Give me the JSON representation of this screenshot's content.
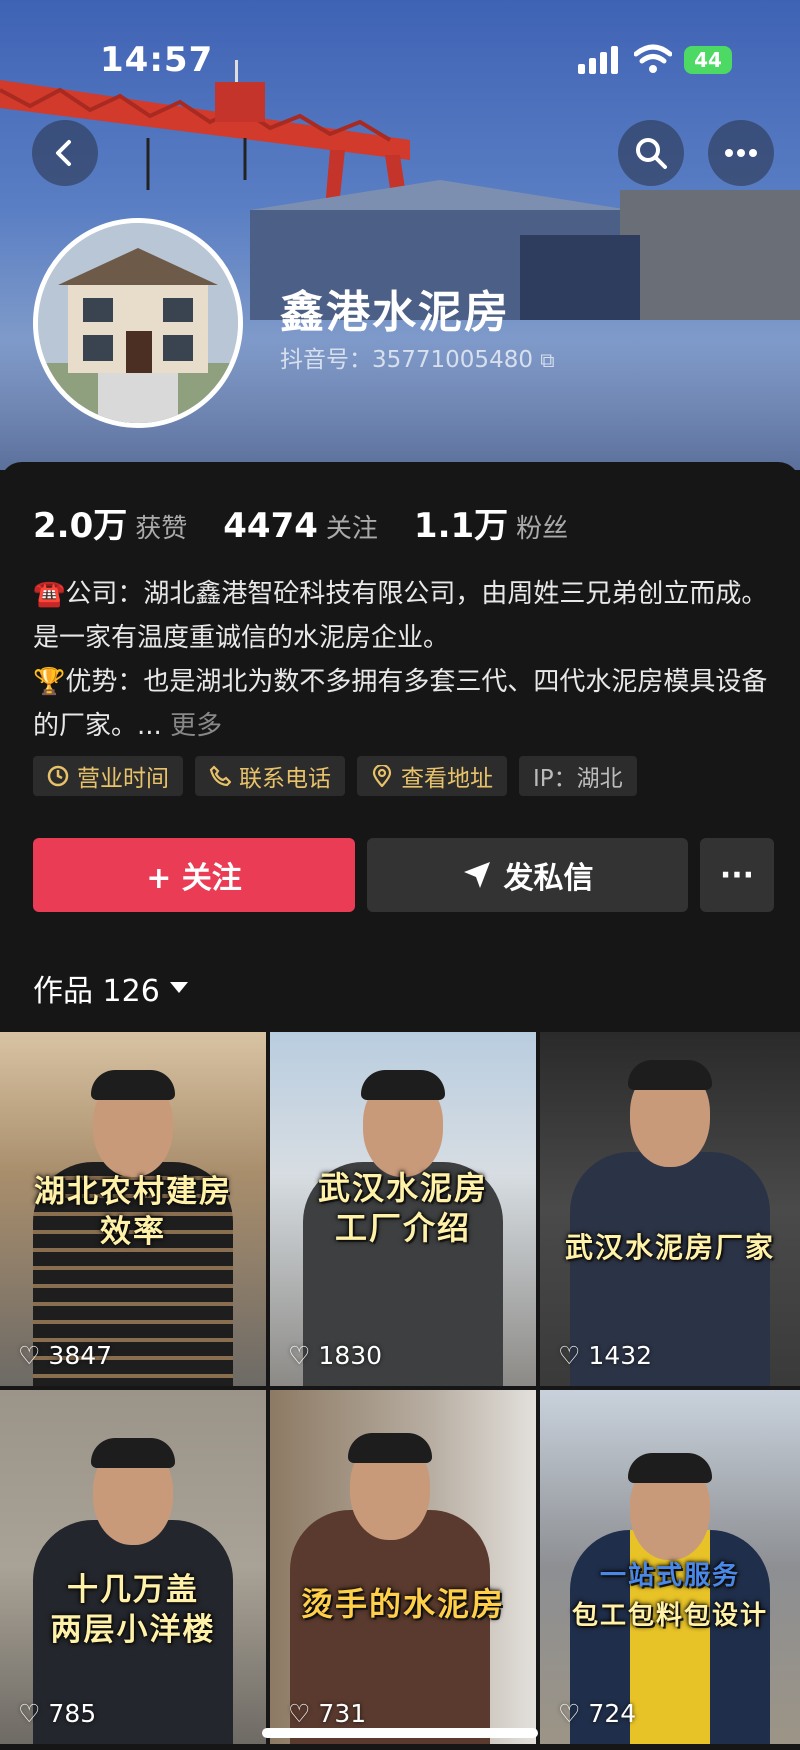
{
  "status_bar": {
    "time": "14:57",
    "battery": "44"
  },
  "profile": {
    "name": "鑫港水泥房",
    "douyin_id": "抖音号：35771005480",
    "stats": [
      {
        "value": "2.0万",
        "label": "获赞"
      },
      {
        "value": "4474",
        "label": "关注"
      },
      {
        "value": "1.1万",
        "label": "粉丝"
      }
    ],
    "bio": {
      "line1": "☎️公司：湖北鑫港智砼科技有限公司，由周姓三兄弟创立而成。是一家有温度重诚信的水泥房企业。",
      "line2": "🏆优势：也是湖北为数不多拥有多套三代、四代水泥房模具设备的厂家。...",
      "more": "更多"
    },
    "tags": [
      {
        "label": "营业时间",
        "icon": "clock-icon"
      },
      {
        "label": "联系电话",
        "icon": "phone-icon"
      },
      {
        "label": "查看地址",
        "icon": "location-pin-icon"
      },
      {
        "label": "IP：湖北",
        "icon": ""
      }
    ]
  },
  "actions": {
    "follow": "+ 关注",
    "message": "发私信",
    "more": "···"
  },
  "works": {
    "label": "作品 126"
  },
  "videos": [
    {
      "caption_line1": "湖北农村建房",
      "caption_line2": "效率",
      "likes": "3847"
    },
    {
      "caption_line1": "武汉水泥房",
      "caption_line2": "工厂介绍",
      "likes": "1830"
    },
    {
      "caption_line1": "武汉水泥房厂家",
      "caption_line2": "",
      "likes": "1432"
    },
    {
      "caption_line1": "十几万盖",
      "caption_line2": "两层小洋楼",
      "likes": "785"
    },
    {
      "caption_line1": "烫手的水泥房",
      "caption_line2": "",
      "likes": "731"
    },
    {
      "caption_line1": "一站式服务",
      "caption_line2": "包工包料包设计",
      "likes": "724"
    }
  ],
  "colors": {
    "accent": "#ea3c55",
    "tag_text": "#e8c26a",
    "background": "#161616"
  }
}
